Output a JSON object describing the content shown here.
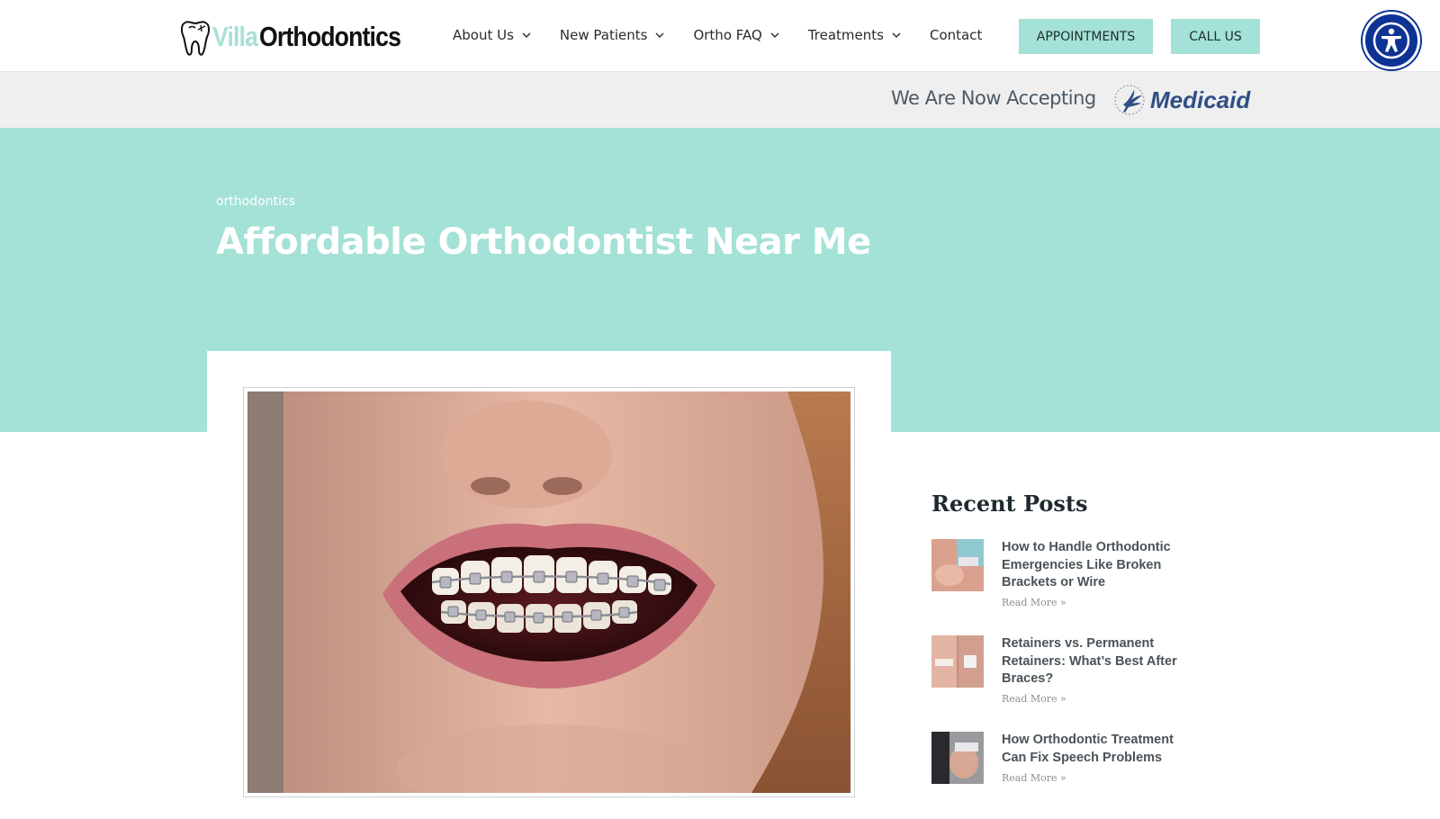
{
  "brand": {
    "name_part1": "Villa",
    "name_part2": "Orthodontics"
  },
  "nav": {
    "items": [
      {
        "label": "About Us"
      },
      {
        "label": "New Patients"
      },
      {
        "label": "Ortho FAQ"
      },
      {
        "label": "Treatments"
      },
      {
        "label": "Contact"
      }
    ],
    "appointments_label": "APPOINTMENTS",
    "call_label": "CALL US"
  },
  "banner": {
    "accepting_text": "We Are Now Accepting",
    "medicaid_text": "Medicaid"
  },
  "hero": {
    "category": "orthodontics",
    "title": "Affordable Orthodontist Near Me"
  },
  "sidebar": {
    "heading": "Recent Posts",
    "posts": [
      {
        "title": "How to Handle Orthodontic Emergencies Like Broken Brackets or Wire",
        "read_more": "Read More »"
      },
      {
        "title": "Retainers vs. Permanent Retainers: What’s Best After Braces?",
        "read_more": "Read More »"
      },
      {
        "title": "How Orthodontic Treatment Can Fix Speech Problems",
        "read_more": "Read More »"
      }
    ]
  },
  "colors": {
    "accent": "#a4e1d6",
    "accessibility": "#0e3394",
    "medicaid": "#2f4f86"
  },
  "icons": {
    "accessibility": "accessibility-person-icon",
    "dropdown": "chevron-down-icon",
    "logo": "tooth-icon"
  }
}
